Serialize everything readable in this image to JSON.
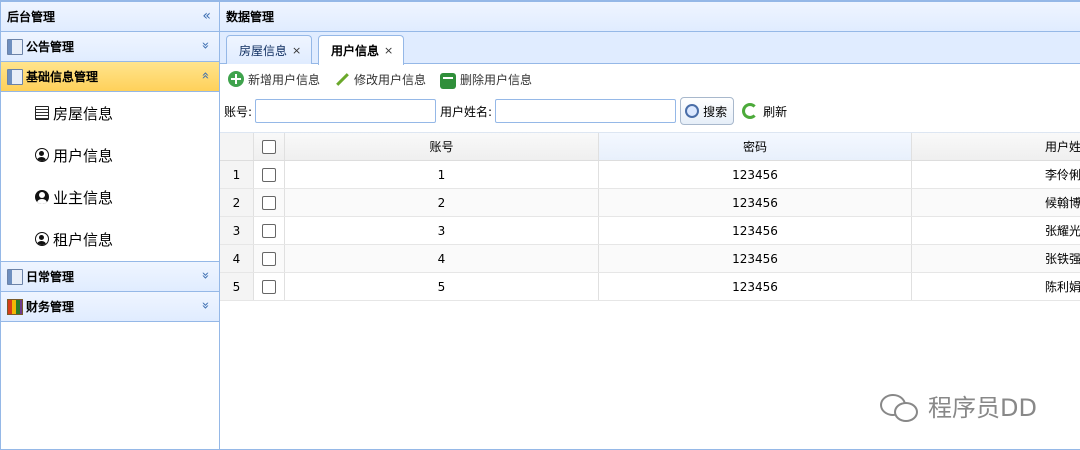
{
  "sidebar": {
    "title": "后台管理",
    "collapse_icon": "«",
    "sections": [
      {
        "label": "公告管理",
        "icon": "book-icon",
        "tool": "»"
      },
      {
        "label": "基础信息管理",
        "icon": "book-icon",
        "tool": "«",
        "selected": true,
        "items": [
          {
            "label": "房屋信息",
            "icon": "document-icon"
          },
          {
            "label": "用户信息",
            "icon": "user-icon"
          },
          {
            "label": "业主信息",
            "icon": "owner-icon"
          },
          {
            "label": "租户信息",
            "icon": "user-icon"
          }
        ]
      },
      {
        "label": "日常管理",
        "icon": "book-icon",
        "tool": "»"
      },
      {
        "label": "财务管理",
        "icon": "color-book-icon",
        "tool": "»"
      }
    ]
  },
  "main": {
    "title": "数据管理",
    "tabs": [
      {
        "label": "房屋信息",
        "close": "×"
      },
      {
        "label": "用户信息",
        "close": "×",
        "active": true
      }
    ],
    "toolbar": {
      "add": "新增用户信息",
      "edit": "修改用户信息",
      "delete": "删除用户信息"
    },
    "search": {
      "account_label": "账号:",
      "name_label": "用户姓名:",
      "search_button": "搜索",
      "refresh_button": "刷新"
    },
    "grid": {
      "columns": [
        "账号",
        "密码",
        "用户姓"
      ],
      "rows": [
        {
          "num": "1",
          "account": "1",
          "password": "123456",
          "name": "李伶俐"
        },
        {
          "num": "2",
          "account": "2",
          "password": "123456",
          "name": "候翰博"
        },
        {
          "num": "3",
          "account": "3",
          "password": "123456",
          "name": "张耀光"
        },
        {
          "num": "4",
          "account": "4",
          "password": "123456",
          "name": "张铁强"
        },
        {
          "num": "5",
          "account": "5",
          "password": "123456",
          "name": "陈利娟"
        }
      ]
    }
  },
  "watermark": "程序员DD",
  "colors": {
    "border": "#95b8e7",
    "header_bg": "#e0ecff",
    "selected": "#ffd15a"
  }
}
